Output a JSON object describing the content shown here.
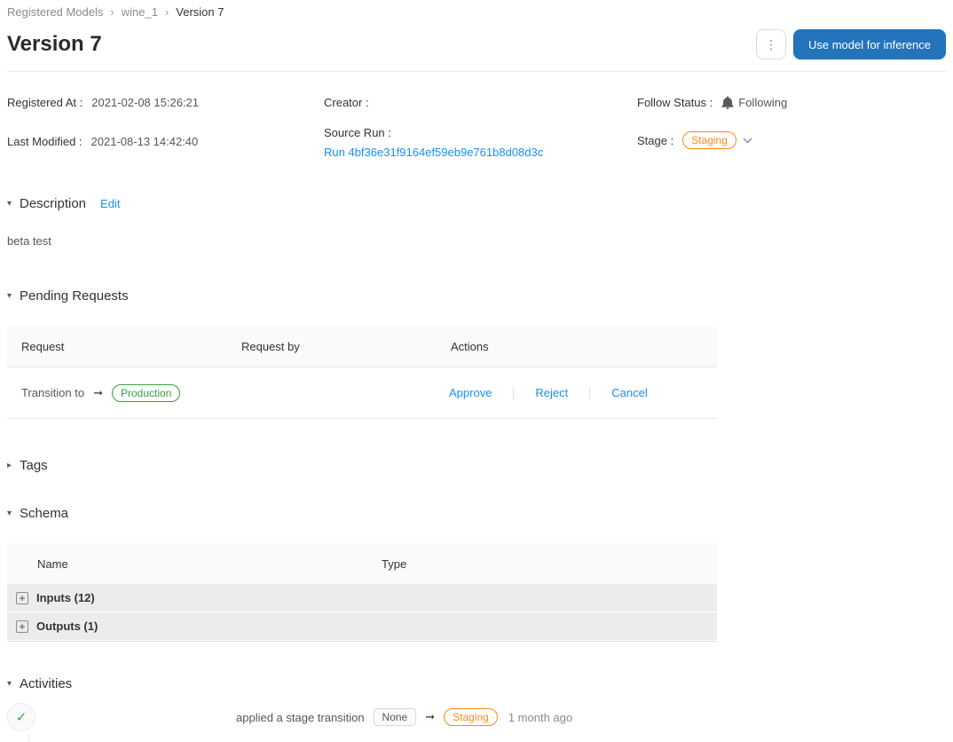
{
  "breadcrumb": {
    "separator": "›",
    "items": [
      "Registered Models",
      "wine_1",
      "Version 7"
    ]
  },
  "header": {
    "title": "Version 7",
    "primary_button": "Use model for inference"
  },
  "metadata": {
    "registered_at": {
      "label": "Registered At :",
      "value": "2021-02-08 15:26:21"
    },
    "last_modified": {
      "label": "Last Modified :",
      "value": "2021-08-13 14:42:40"
    },
    "creator": {
      "label": "Creator :",
      "value": ""
    },
    "source_run": {
      "label": "Source Run :",
      "link": "Run 4bf36e31f9164ef59eb9e761b8d08d3c"
    },
    "follow_status": {
      "label": "Follow Status :",
      "value": "Following"
    },
    "stage": {
      "label": "Stage :",
      "value": "Staging"
    }
  },
  "description": {
    "title": "Description",
    "edit_label": "Edit",
    "content": "beta test"
  },
  "pending_requests": {
    "title": "Pending Requests",
    "columns": [
      "Request",
      "Request by",
      "Actions"
    ],
    "rows": [
      {
        "request_prefix": "Transition to",
        "target_stage": "Production",
        "request_by": "",
        "actions": [
          "Approve",
          "Reject",
          "Cancel"
        ]
      }
    ]
  },
  "tags": {
    "title": "Tags"
  },
  "schema": {
    "title": "Schema",
    "columns": [
      "Name",
      "Type"
    ],
    "rows": [
      {
        "name": "Inputs (12)"
      },
      {
        "name": "Outputs (1)"
      }
    ]
  },
  "activities": {
    "title": "Activities",
    "items": [
      {
        "description": "applied a stage transition",
        "from_stage": "None",
        "to_stage": "Staging",
        "time": "1 month ago"
      }
    ]
  },
  "icons": {
    "kebab": "⋮",
    "triangle_down": "▾",
    "triangle_right": "▸",
    "arrow_right": "➞",
    "plus": "+",
    "check": "✓"
  },
  "colors": {
    "primary_button": "#2374bb",
    "link": "#1890ff",
    "stage_orange": "#fa8c16",
    "stage_green": "#34a33e",
    "check_green": "#34a853",
    "muted_text": "#8c8c8c",
    "table_header_bg": "#fafafa",
    "schema_row_bg": "#ececec"
  }
}
